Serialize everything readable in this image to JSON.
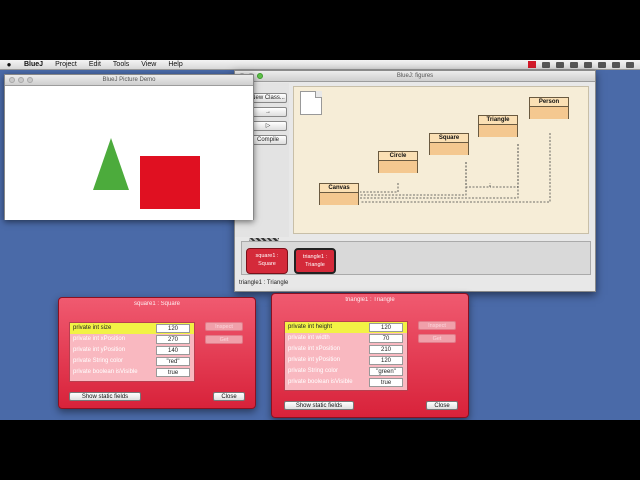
{
  "menubar": {
    "apple": "",
    "items": [
      "BlueJ",
      "Project",
      "Edit",
      "Tools",
      "View",
      "Help"
    ]
  },
  "picture_window": {
    "title": "BlueJ Picture Demo"
  },
  "bluej_window": {
    "title": "BlueJ:  figures",
    "side_buttons": [
      "New Class...",
      "→",
      "▷",
      "Compile"
    ],
    "classes": [
      "Canvas",
      "Circle",
      "Square",
      "Triangle",
      "Person"
    ],
    "objects": [
      {
        "line1": "square1 :",
        "line2": "Square"
      },
      {
        "line1": "triangle1 :",
        "line2": "Triangle"
      }
    ],
    "status": "triangle1 : Triangle"
  },
  "inspector_square": {
    "title": "square1 : Square",
    "fields": [
      {
        "name": "private int size",
        "value": "120"
      },
      {
        "name": "private int xPosition",
        "value": "270"
      },
      {
        "name": "private int yPosition",
        "value": "140"
      },
      {
        "name": "private String color",
        "value": "\"red\""
      },
      {
        "name": "private boolean isVisible",
        "value": "true"
      }
    ],
    "inspect": "Inspect",
    "get": "Get",
    "show_static": "Show static fields",
    "close": "Close"
  },
  "inspector_triangle": {
    "title": "triangle1 : Triangle",
    "fields": [
      {
        "name": "private int height",
        "value": "120"
      },
      {
        "name": "private int width",
        "value": "70"
      },
      {
        "name": "private int xPosition",
        "value": "210"
      },
      {
        "name": "private int yPosition",
        "value": "120"
      },
      {
        "name": "private String color",
        "value": "\"green\""
      },
      {
        "name": "private boolean isVisible",
        "value": "true"
      }
    ],
    "inspect": "Inspect",
    "get": "Get",
    "show_static": "Show static fields",
    "close": "Close"
  },
  "colors": {
    "desktop": "#4a6aa8",
    "shape_triangle": "#4cab3c",
    "shape_square": "#e01021",
    "inspector": "#d8223a"
  }
}
